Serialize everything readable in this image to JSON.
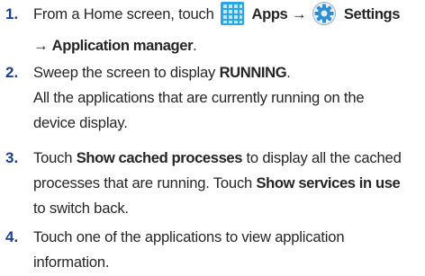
{
  "steps": [
    {
      "number": "1.",
      "line1_pre": "From a Home screen, touch",
      "apps_icon": "apps-grid-icon",
      "apps": "Apps",
      "arrow": "→",
      "settings_icon": "settings-gear-icon",
      "settings": "Settings",
      "line2_arrow": "→",
      "line2_bold": "Application manager",
      "line2_post": "."
    },
    {
      "number": "2.",
      "line1_pre": "Sweep the screen to display",
      "line1_bold": "RUNNING",
      "line1_post": ".",
      "para_line1": "All the applications that are currently running on the",
      "para_line2": "device display."
    },
    {
      "number": "3.",
      "line1_pre": "Touch",
      "line1_bold": "Show cached processes",
      "line1_post": "to display all the cached",
      "line2_pre": "processes that are running. Touch",
      "line2_bold": "Show services in use",
      "line3": "to switch back."
    },
    {
      "number": "4.",
      "line1": "Touch one of the applications to view application",
      "line2": "information."
    }
  ],
  "colors": {
    "step_number": "#1c3f8f",
    "apps_icon": "#2aa7e0",
    "settings_icon": "#2c8fd6"
  }
}
